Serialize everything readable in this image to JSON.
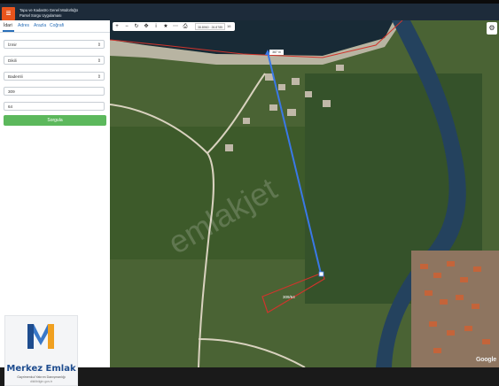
{
  "header": {
    "title_line1": "Tapu ve Kadastro Genel Müdürlüğü",
    "title_line2": "Parsel Sorgu Uygulaması",
    "menu_icon": "hamburger-icon"
  },
  "tabs": [
    {
      "label": "İdari"
    },
    {
      "label": "Adres"
    },
    {
      "label": "Arazla"
    },
    {
      "label": "Coğrafi"
    }
  ],
  "form": {
    "province": "İzmir",
    "district": "Dikili",
    "neighborhood": "Bademli",
    "block": "309",
    "parcel": "64",
    "submit_label": "Sorgula"
  },
  "toolbar": {
    "coords": "38.8960 : 26.8785",
    "zoom": "16"
  },
  "map": {
    "measure_label": "387 m",
    "parcel_label": "309/64",
    "google_text": "Google",
    "watermark": "emlakjet"
  },
  "logo": {
    "name": "Merkez Emlak",
    "tagline": "Gayrimenkul Yatırım Danışmanlığı",
    "url": "dikilibilgin.gov.tr"
  },
  "colors": {
    "header_bg": "#1d2b3a",
    "menu_accent": "#e8541c",
    "submit_green": "#5cb85c",
    "tab_blue": "#2a6fb8",
    "parcel_red": "#d0342c",
    "measure_blue": "#3a78e6"
  }
}
